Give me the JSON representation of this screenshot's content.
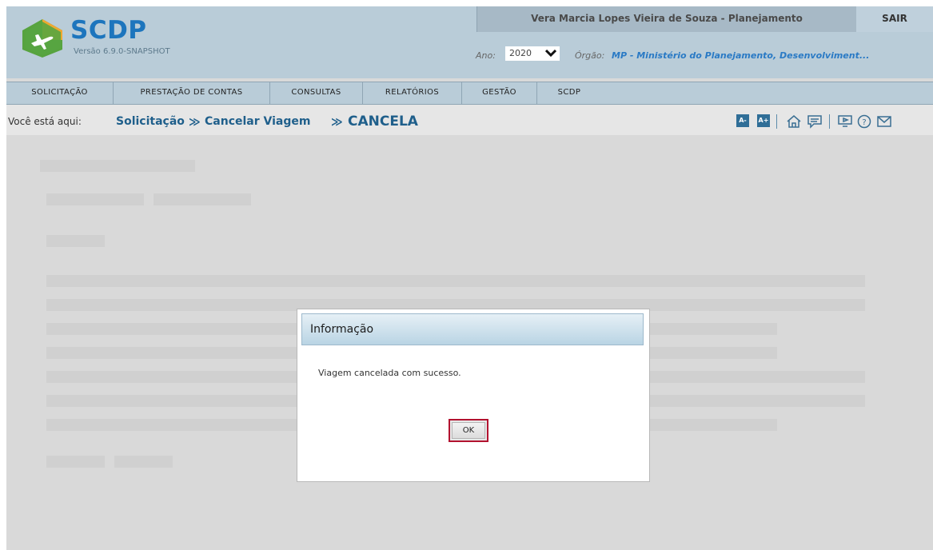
{
  "app": {
    "title": "SCDP",
    "version": "Versão 6.9.0-SNAPSHOT",
    "brand_color": "#1d75bd"
  },
  "header": {
    "user_name": "Vera Marcia Lopes Vieira de Souza - Planejamento",
    "logout_label": "SAIR",
    "ano_label": "Ano:",
    "ano_value": "2020",
    "orgao_label": "Órgão:",
    "orgao_value": "MP - Ministério do Planejamento, Desenvolviment..."
  },
  "menu": {
    "items": [
      {
        "label": "SOLICITAÇÃO"
      },
      {
        "label": "PRESTAÇÃO DE CONTAS"
      },
      {
        "label": "CONSULTAS"
      },
      {
        "label": "RELATÓRIOS"
      },
      {
        "label": "GESTÃO"
      },
      {
        "label": "SCDP"
      }
    ]
  },
  "breadcrumb": {
    "prefix": "Você está aqui:",
    "items": [
      "Solicitação",
      "Cancelar Viagem",
      "CANCELA"
    ],
    "separator": "≫"
  },
  "toolbar": {
    "decrease_font": "A-",
    "increase_font": "A+",
    "icons": [
      "font-decrease-icon",
      "font-increase-icon",
      "home-icon",
      "chat-icon",
      "video-icon",
      "help-icon",
      "mail-icon"
    ]
  },
  "dialog": {
    "title": "Informação",
    "message": "Viagem cancelada com sucesso.",
    "ok_label": "OK",
    "highlight_color": "#b2122f"
  }
}
